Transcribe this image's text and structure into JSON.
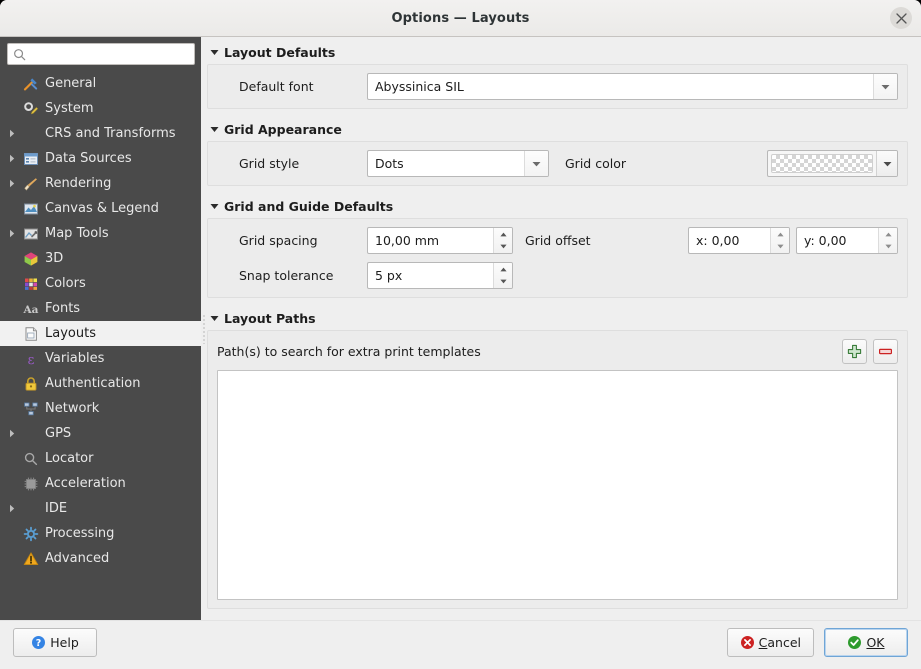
{
  "window": {
    "title": "Options — Layouts",
    "close_icon": "close-icon"
  },
  "sidebar": {
    "search": {
      "value": "",
      "placeholder": "",
      "icon": "search-icon"
    },
    "items": [
      {
        "label": "General",
        "icon": "hammer-wrench-icon",
        "expandable": false,
        "selected": false
      },
      {
        "label": "System",
        "icon": "gear-pencil-icon",
        "expandable": false,
        "selected": false
      },
      {
        "label": "CRS and Transforms",
        "icon": "none",
        "expandable": true,
        "selected": false
      },
      {
        "label": "Data Sources",
        "icon": "table-icon",
        "expandable": true,
        "selected": false
      },
      {
        "label": "Rendering",
        "icon": "brush-icon",
        "expandable": true,
        "selected": false
      },
      {
        "label": "Canvas & Legend",
        "icon": "map-canvas-icon",
        "expandable": false,
        "selected": false
      },
      {
        "label": "Map Tools",
        "icon": "map-tools-icon",
        "expandable": true,
        "selected": false
      },
      {
        "label": "3D",
        "icon": "cube-icon",
        "expandable": false,
        "selected": false
      },
      {
        "label": "Colors",
        "icon": "color-palette-icon",
        "expandable": false,
        "selected": false
      },
      {
        "label": "Fonts",
        "icon": "fonts-aa-icon",
        "expandable": false,
        "selected": false
      },
      {
        "label": "Layouts",
        "icon": "layout-page-icon",
        "expandable": false,
        "selected": true
      },
      {
        "label": "Variables",
        "icon": "epsilon-icon",
        "expandable": false,
        "selected": false
      },
      {
        "label": "Authentication",
        "icon": "padlock-icon",
        "expandable": false,
        "selected": false
      },
      {
        "label": "Network",
        "icon": "network-icon",
        "expandable": false,
        "selected": false
      },
      {
        "label": "GPS",
        "icon": "none",
        "expandable": true,
        "selected": false
      },
      {
        "label": "Locator",
        "icon": "search-icon",
        "expandable": false,
        "selected": false
      },
      {
        "label": "Acceleration",
        "icon": "chip-icon",
        "expandable": false,
        "selected": false
      },
      {
        "label": "IDE",
        "icon": "none",
        "expandable": true,
        "selected": false
      },
      {
        "label": "Processing",
        "icon": "gear-blue-icon",
        "expandable": false,
        "selected": false
      },
      {
        "label": "Advanced",
        "icon": "warning-triangle-icon",
        "expandable": false,
        "selected": false
      }
    ]
  },
  "content": {
    "layout_defaults": {
      "title": "Layout Defaults",
      "default_font_label": "Default font",
      "default_font_value": "Abyssinica SIL"
    },
    "grid_appearance": {
      "title": "Grid Appearance",
      "grid_style_label": "Grid style",
      "grid_style_value": "Dots",
      "grid_color_label": "Grid color",
      "grid_color_value": "transparent"
    },
    "grid_guide_defaults": {
      "title": "Grid and Guide Defaults",
      "grid_spacing_label": "Grid spacing",
      "grid_spacing_value": "10,00 mm",
      "grid_offset_label": "Grid offset",
      "grid_offset_x_value": "x: 0,00",
      "grid_offset_y_value": "y: 0,00",
      "snap_tolerance_label": "Snap tolerance",
      "snap_tolerance_value": "5 px"
    },
    "layout_paths": {
      "title": "Layout Paths",
      "description": "Path(s) to search for extra print templates",
      "add_button_icon": "plus-icon",
      "remove_button_icon": "minus-icon",
      "entries": []
    }
  },
  "footer": {
    "help_label": "Help",
    "cancel_label": "Cancel",
    "ok_label": "OK",
    "help_icon": "question-icon",
    "cancel_icon": "cancel-x-icon",
    "ok_icon": "check-icon"
  },
  "colors": {
    "sidebar_bg": "#4a4a4a",
    "dialog_bg": "#efefef",
    "accent_ok": "#2e9b2e",
    "accent_cancel": "#cc2222",
    "accent_help": "#3584e4"
  }
}
